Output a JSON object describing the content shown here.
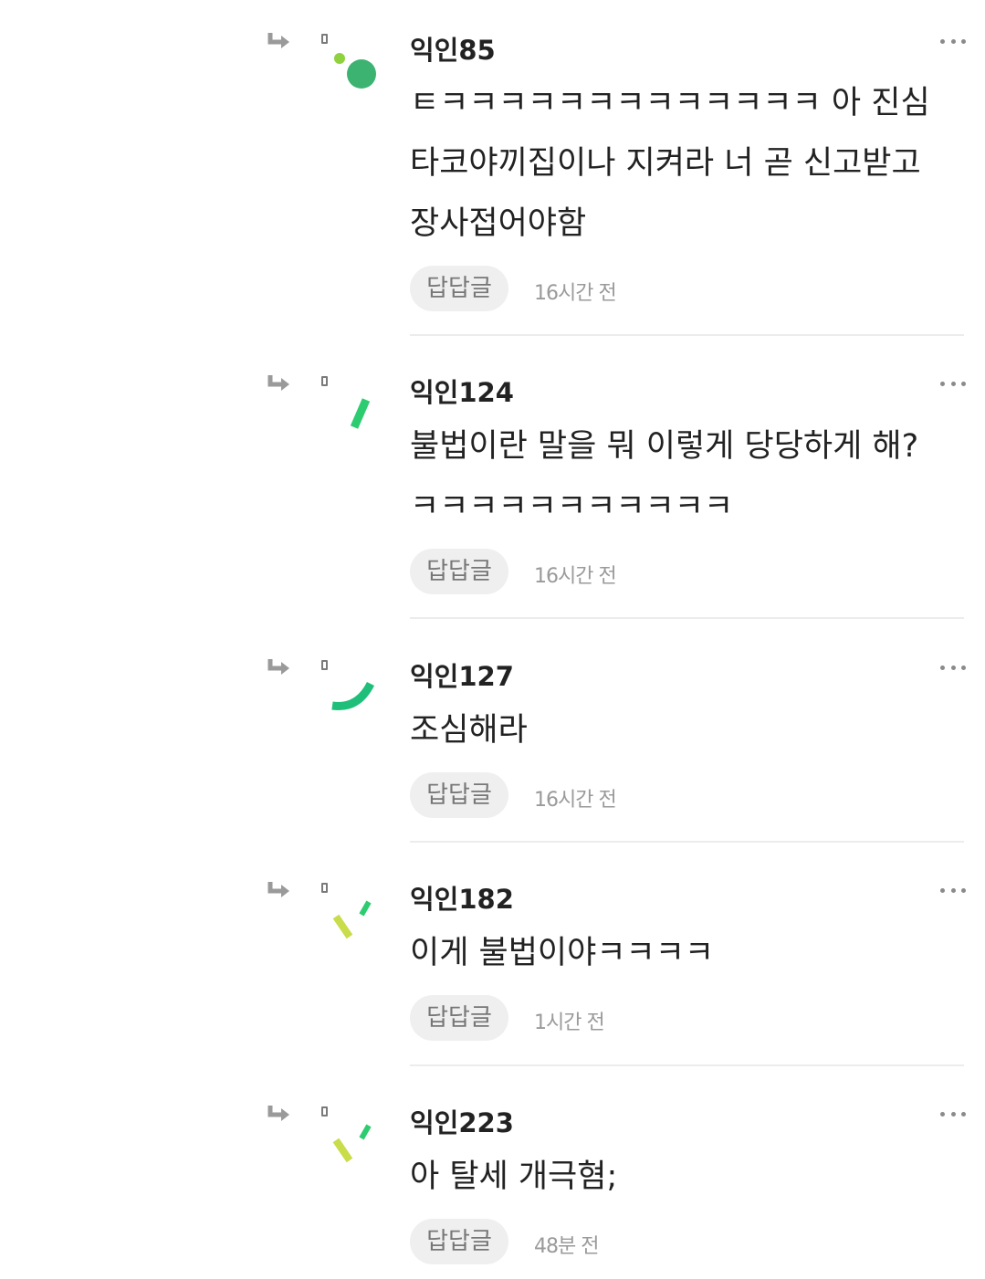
{
  "comments": [
    {
      "author": "익인85",
      "lines": [
        "ㅌㅋㅋㅋㅋㅋㅋㅋㅋㅋㅋㅋㅋㅋ 아 진심",
        "타코야끼집이나 지켜라 너 곧 신고받고",
        "장사접어야함"
      ],
      "reply_label": "답답글",
      "time": "16시간 전"
    },
    {
      "author": "익인124",
      "lines": [
        "불법이란 말을 뭐 이렇게 당당하게 해?",
        "ㅋㅋㅋㅋㅋㅋㅋㅋㅋㅋㅋ"
      ],
      "reply_label": "답답글",
      "time": "16시간 전"
    },
    {
      "author": "익인127",
      "lines": [
        "조심해라"
      ],
      "reply_label": "답답글",
      "time": "16시간 전"
    },
    {
      "author": "익인182",
      "lines": [
        "이게 불법이야ㅋㅋㅋㅋ"
      ],
      "reply_label": "답답글",
      "time": "1시간 전"
    },
    {
      "author": "익인223",
      "lines": [
        "아 탈세 개극혐;"
      ],
      "reply_label": "답답글",
      "time": "48분 전"
    }
  ],
  "icons": {
    "reply_arrow": "reply-arrow-icon",
    "more": "more-options-icon"
  },
  "colors": {
    "avatar_dark_green": "#3cb371",
    "avatar_green": "#2ecc71",
    "avatar_lime": "#8fd13f",
    "avatar_yellow_green": "#c9dc4a"
  }
}
